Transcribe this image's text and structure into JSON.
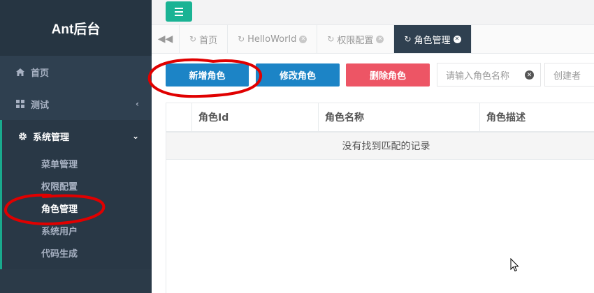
{
  "sidebar": {
    "brand": "Ant后台",
    "items": [
      {
        "label": "首页",
        "icon": "home-icon"
      },
      {
        "label": "测试",
        "icon": "grid-icon"
      }
    ],
    "group": {
      "label": "系统管理",
      "icon": "gear-icon",
      "children": [
        "菜单管理",
        "权限配置",
        "角色管理",
        "系统用户",
        "代码生成"
      ]
    }
  },
  "tabs": [
    {
      "label": "首页",
      "icon": "refresh-icon"
    },
    {
      "label": "HelloWorld",
      "icon": "refresh-icon"
    },
    {
      "label": "权限配置",
      "icon": "refresh-icon"
    },
    {
      "label": "角色管理",
      "icon": "refresh-icon",
      "active": true
    }
  ],
  "toolbar": {
    "add_label": "新增角色",
    "edit_label": "修改角色",
    "delete_label": "删除角色"
  },
  "search": {
    "role_name_placeholder": "请输入角色名称",
    "creator_placeholder": "创建者"
  },
  "table": {
    "columns": [
      "角色Id",
      "角色名称",
      "角色描述"
    ],
    "empty_text": "没有找到匹配的记录"
  },
  "colors": {
    "sidebar_bg": "#2f4050",
    "accent_green": "#1ab394",
    "primary_blue": "#1c84c6",
    "danger_red": "#ed5565",
    "annotation_red": "#e00000"
  }
}
